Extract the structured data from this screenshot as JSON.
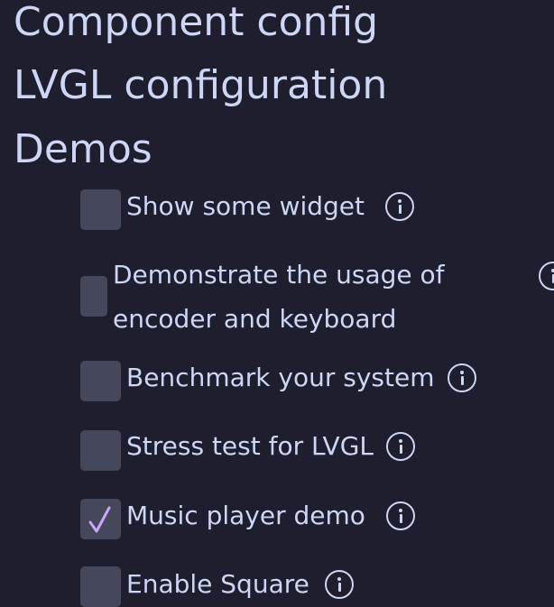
{
  "headings": {
    "component_config": "Component config",
    "lvgl_configuration": "LVGL configuration",
    "demos": "Demos"
  },
  "demos": [
    {
      "label": "Show some widget",
      "checked": false
    },
    {
      "label_line1": "Demonstrate the usage of",
      "label_line2": "encoder and keyboard",
      "checked": false
    },
    {
      "label": "Benchmark your system",
      "checked": false
    },
    {
      "label": "Stress test for LVGL",
      "checked": false
    },
    {
      "label": "Music player demo",
      "checked": true
    },
    {
      "label": "Enable Square",
      "checked": false
    }
  ],
  "icons": {
    "info": "info-circle-icon",
    "check": "checkmark-icon"
  },
  "colors": {
    "background": "#1e1e2e",
    "text": "#cdd6f4",
    "checkbox": "#45475a",
    "checkmark": "#cba6f7"
  }
}
